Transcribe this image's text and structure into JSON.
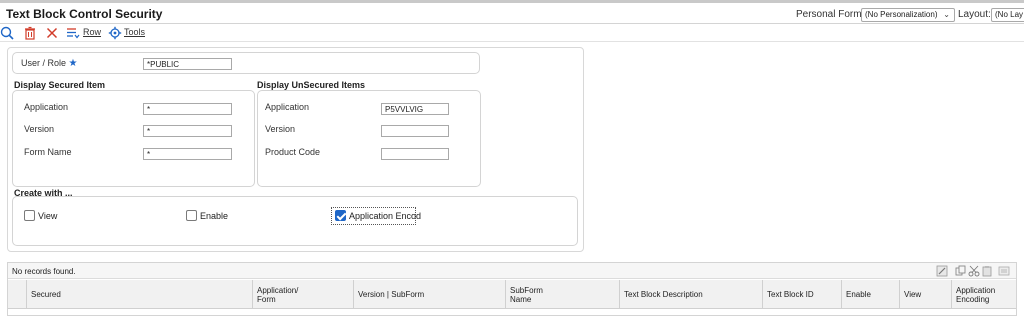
{
  "header": {
    "title": "Text Block Control Security",
    "personal_form_label": "Personal Form:",
    "personal_form_value": "(No Personalization)",
    "layout_label": "Layout:",
    "layout_value": "(No Lay"
  },
  "toolbar": {
    "row_label": "Row",
    "tools_label": "Tools"
  },
  "form": {
    "user_role_label": "User / Role",
    "user_role_value": "*PUBLIC",
    "secured": {
      "title": "Display Secured Item",
      "application_label": "Application",
      "application_value": "*",
      "version_label": "Version",
      "version_value": "*",
      "form_name_label": "Form Name",
      "form_name_value": "*"
    },
    "unsecured": {
      "title": "Display UnSecured Items",
      "application_label": "Application",
      "application_value": "P5VVLVIG",
      "version_label": "Version",
      "version_value": "",
      "product_code_label": "Product Code",
      "product_code_value": ""
    },
    "create_with": {
      "title": "Create with ...",
      "view_label": "View",
      "view_checked": false,
      "enable_label": "Enable",
      "enable_checked": false,
      "encoding_label": "Application Encod",
      "encoding_checked": true
    }
  },
  "grid": {
    "status": "No records found.",
    "columns": [
      {
        "line1": "Secured",
        "line2": ""
      },
      {
        "line1": "Application/",
        "line2": "Form"
      },
      {
        "line1": "Version | SubForm",
        "line2": ""
      },
      {
        "line1": "SubForm",
        "line2": "Name"
      },
      {
        "line1": "Text Block Description",
        "line2": ""
      },
      {
        "line1": "Text Block ID",
        "line2": ""
      },
      {
        "line1": "Enable",
        "line2": ""
      },
      {
        "line1": "View",
        "line2": ""
      },
      {
        "line1": "Application",
        "line2": "Encoding"
      }
    ]
  },
  "colors": {
    "accent": "#1e66c7",
    "delete_red": "#d23c2a"
  }
}
